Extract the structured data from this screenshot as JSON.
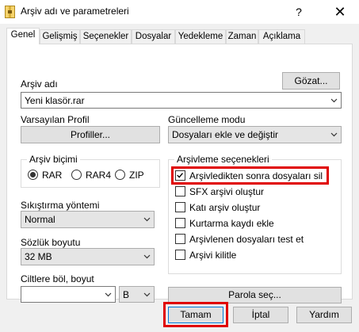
{
  "window": {
    "title": "Arşiv adı ve parametreleri",
    "help_glyph": "?",
    "close_glyph": "✕"
  },
  "tabs": [
    "Genel",
    "Gelişmiş",
    "Seçenekler",
    "Dosyalar",
    "Yedekleme",
    "Zaman",
    "Açıklama"
  ],
  "archive_name": {
    "label": "Arşiv adı",
    "browse_button": "Gözat...",
    "value": "Yeni klasör.rar"
  },
  "default_profile": {
    "label": "Varsayılan Profil",
    "button": "Profiller..."
  },
  "update_mode": {
    "label": "Güncelleme modu",
    "value": "Dosyaları ekle ve değiştir"
  },
  "archive_format": {
    "label": "Arşiv biçimi",
    "options": [
      "RAR",
      "RAR4",
      "ZIP"
    ],
    "selected": "RAR"
  },
  "compression": {
    "label": "Sıkıştırma yöntemi",
    "value": "Normal"
  },
  "dictionary": {
    "label": "Sözlük boyutu",
    "value": "32 MB"
  },
  "split": {
    "label": "Ciltlere böl, boyut",
    "value": "",
    "unit": "B"
  },
  "archive_options": {
    "label": "Arşivleme seçenekleri",
    "items": [
      {
        "label": "Arşivledikten sonra dosyaları sil",
        "checked": true
      },
      {
        "label": "SFX arşivi oluştur",
        "checked": false
      },
      {
        "label": "Katı arşiv oluştur",
        "checked": false
      },
      {
        "label": "Kurtarma kaydı ekle",
        "checked": false
      },
      {
        "label": "Arşivlenen dosyaları test et",
        "checked": false
      },
      {
        "label": "Arşivi kilitle",
        "checked": false
      }
    ]
  },
  "password_button": "Parola seç...",
  "footer": {
    "ok": "Tamam",
    "cancel": "İptal",
    "help": "Yardım"
  },
  "colors": {
    "highlight": "#e00000",
    "check": "#000000"
  }
}
